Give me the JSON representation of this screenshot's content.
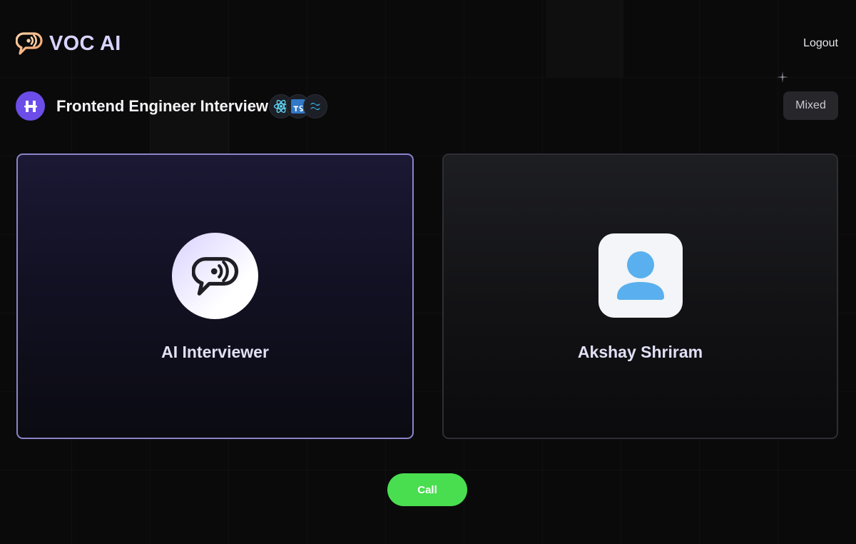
{
  "header": {
    "logo_text": "VOC AI",
    "logo_icon": "chat-bubble-broadcast-icon",
    "logout_label": "Logout"
  },
  "interview": {
    "title": "Frontend Engineer Interview",
    "avatar_icon": "hashnode-logo-icon",
    "tech_stack": [
      {
        "name": "React",
        "icon": "react-icon",
        "color": "#61dafb"
      },
      {
        "name": "TypeScript",
        "icon": "typescript-icon",
        "color": "#3178c6"
      },
      {
        "name": "Tailwind CSS",
        "icon": "tailwind-icon",
        "color": "#38bdf8"
      }
    ],
    "type_badge": "Mixed"
  },
  "cards": {
    "ai": {
      "name": "AI Interviewer",
      "icon": "chat-bubble-broadcast-icon"
    },
    "user": {
      "name": "Akshay Shriram",
      "icon": "user-silhouette-icon"
    }
  },
  "call_button": {
    "label": "Call"
  },
  "colors": {
    "background": "#0a0a0b",
    "brand_purple": "#6c4de8",
    "logo_text": "#d9d4ff",
    "ai_card_border": "#8a85c8",
    "call_green": "#49de50",
    "user_avatar_blue": "#5ab0ee"
  }
}
